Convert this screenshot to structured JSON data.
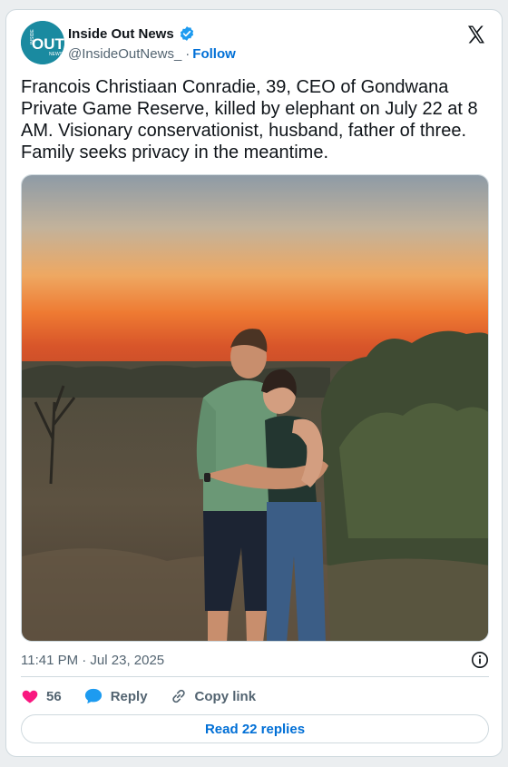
{
  "author": {
    "display_name": "Inside Out News",
    "handle": "@InsideOutNews_",
    "separator": "·",
    "follow_label": "Follow",
    "avatar_text": "OUT",
    "avatar_side_text": "INSIDE",
    "avatar_sub_text": "NEWS",
    "verified_color": "#1d9bf0",
    "avatar_color": "#1a8aa0"
  },
  "tweet": {
    "text": "Francois Christiaan Conradie, 39, CEO of Gondwana Private Game Reserve, killed by elephant on July 22 at 8 AM. Visionary conservationist, husband, father of three. Family seeks privacy in the meantime.",
    "timestamp": "11:41 PM · Jul 23, 2025",
    "image_description_icon": "photo-of-couple-at-sunset"
  },
  "actions": {
    "like_count": "56",
    "reply_label": "Reply",
    "copy_link_label": "Copy link",
    "read_replies_label": "Read 22 replies"
  },
  "colors": {
    "accent": "#006fd6",
    "like": "#f91880",
    "reply": "#1d9bf0",
    "text": "#0f1419",
    "secondary": "#536471"
  },
  "icons": {
    "platform": "x-logo-icon",
    "info": "info-icon",
    "like": "heart-icon",
    "reply": "speech-bubble-icon",
    "copy": "link-icon"
  }
}
